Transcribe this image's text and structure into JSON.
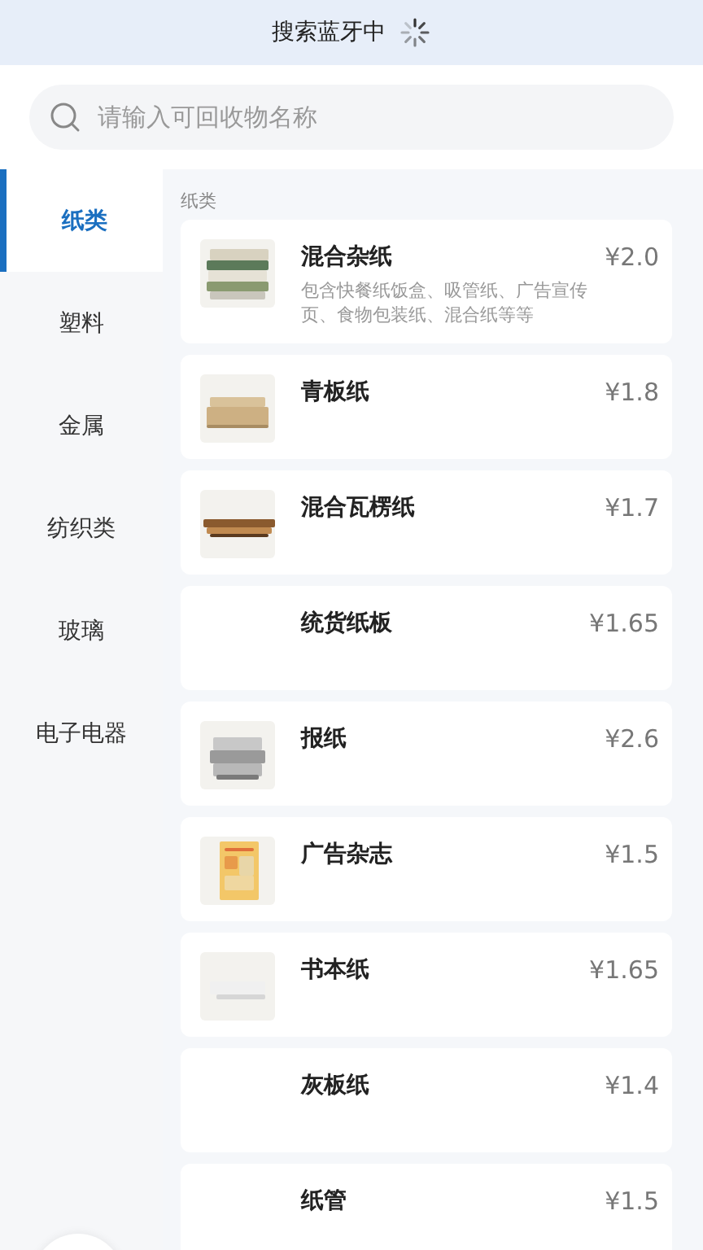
{
  "status": {
    "title": "搜索蓝牙中",
    "loading": true
  },
  "search": {
    "placeholder": "请输入可回收物名称"
  },
  "sidebar": {
    "items": [
      {
        "label": "纸类",
        "selected": true
      },
      {
        "label": "塑料",
        "selected": false
      },
      {
        "label": "金属",
        "selected": false
      },
      {
        "label": "纺织类",
        "selected": false
      },
      {
        "label": "玻璃",
        "selected": false
      },
      {
        "label": "电子电器",
        "selected": false
      }
    ]
  },
  "section_title": "纸类",
  "items": [
    {
      "name": "混合杂纸",
      "price": "¥2.0",
      "description": "包含快餐纸饭盒、吸管纸、广告宣传页、食物包装纸、混合纸等等"
    },
    {
      "name": "青板纸",
      "price": "¥1.8"
    },
    {
      "name": "混合瓦楞纸",
      "price": "¥1.7"
    },
    {
      "name": "统货纸板",
      "price": "¥1.65"
    },
    {
      "name": "报纸",
      "price": "¥2.6"
    },
    {
      "name": "广告杂志",
      "price": "¥1.5"
    },
    {
      "name": "书本纸",
      "price": "¥1.65"
    },
    {
      "name": "灰板纸",
      "price": "¥1.4"
    },
    {
      "name": "纸管",
      "price": "¥1.5"
    }
  ]
}
